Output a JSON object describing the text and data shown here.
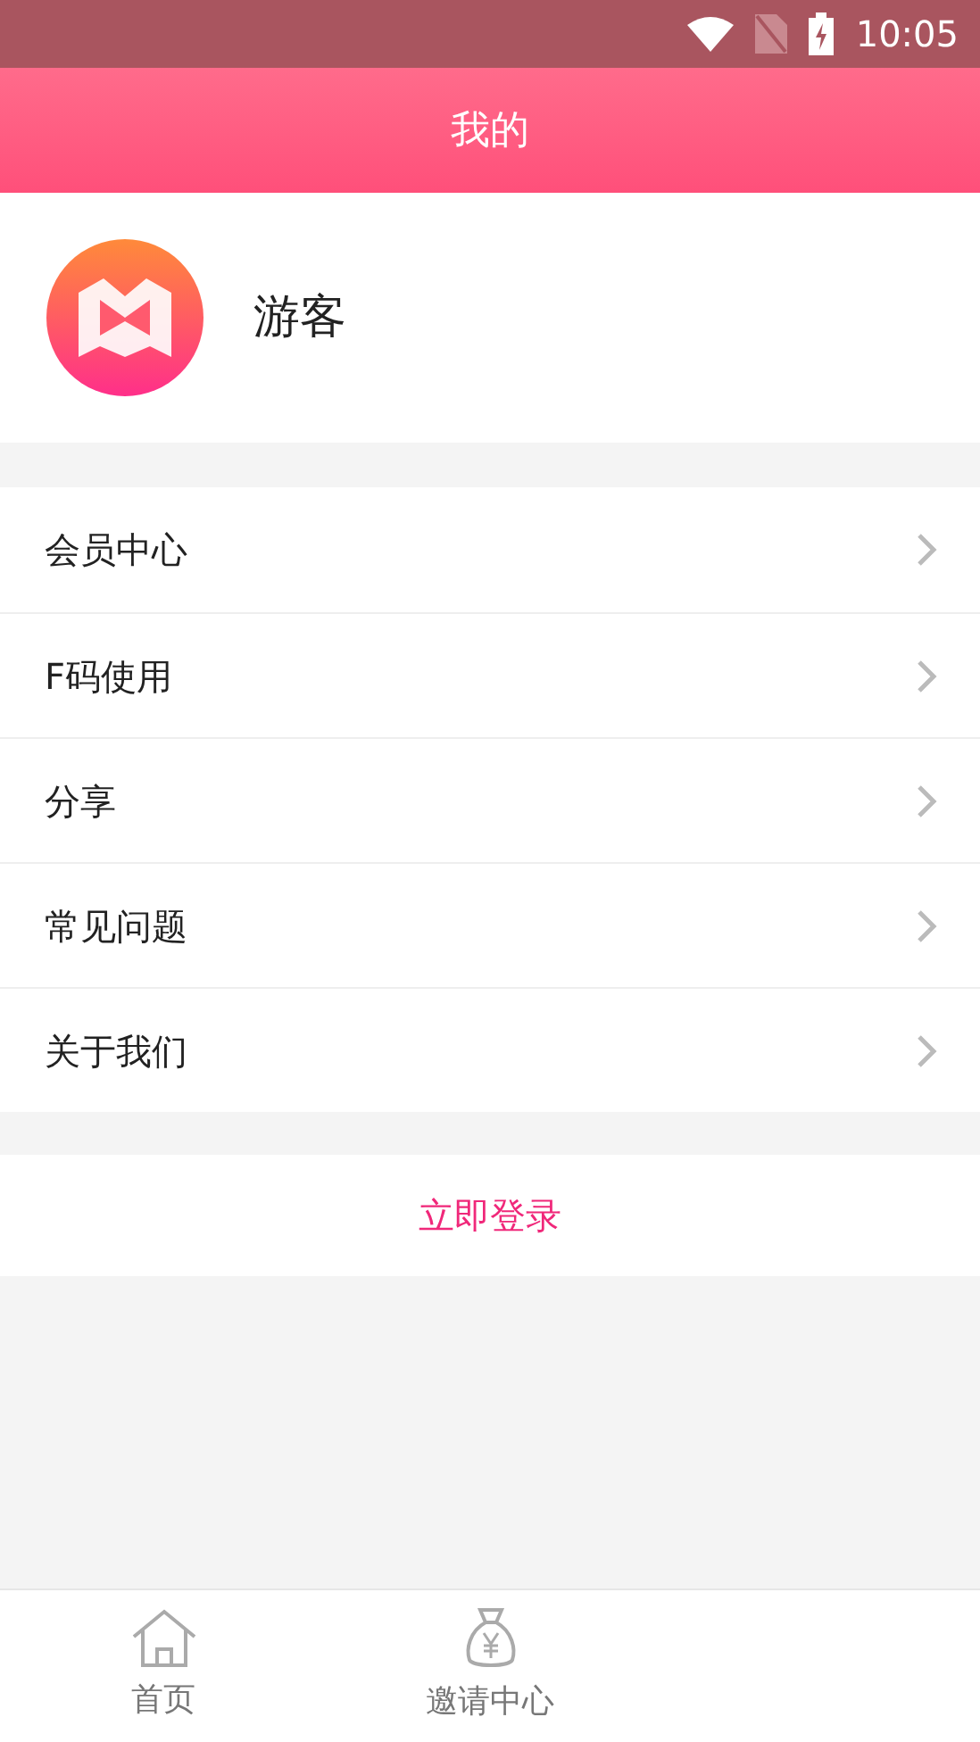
{
  "status_bar": {
    "time": "10:05"
  },
  "header": {
    "title": "我的"
  },
  "profile": {
    "name": "游客"
  },
  "menu": [
    {
      "label": "会员中心"
    },
    {
      "label": "F码使用"
    },
    {
      "label": "分享"
    },
    {
      "label": "常见问题"
    },
    {
      "label": "关于我们"
    }
  ],
  "login_button": "立即登录",
  "tab_bar": [
    {
      "kind": "home",
      "label": "首页",
      "selected": false
    },
    {
      "kind": "money",
      "label": "邀请中心",
      "selected": false
    }
  ]
}
